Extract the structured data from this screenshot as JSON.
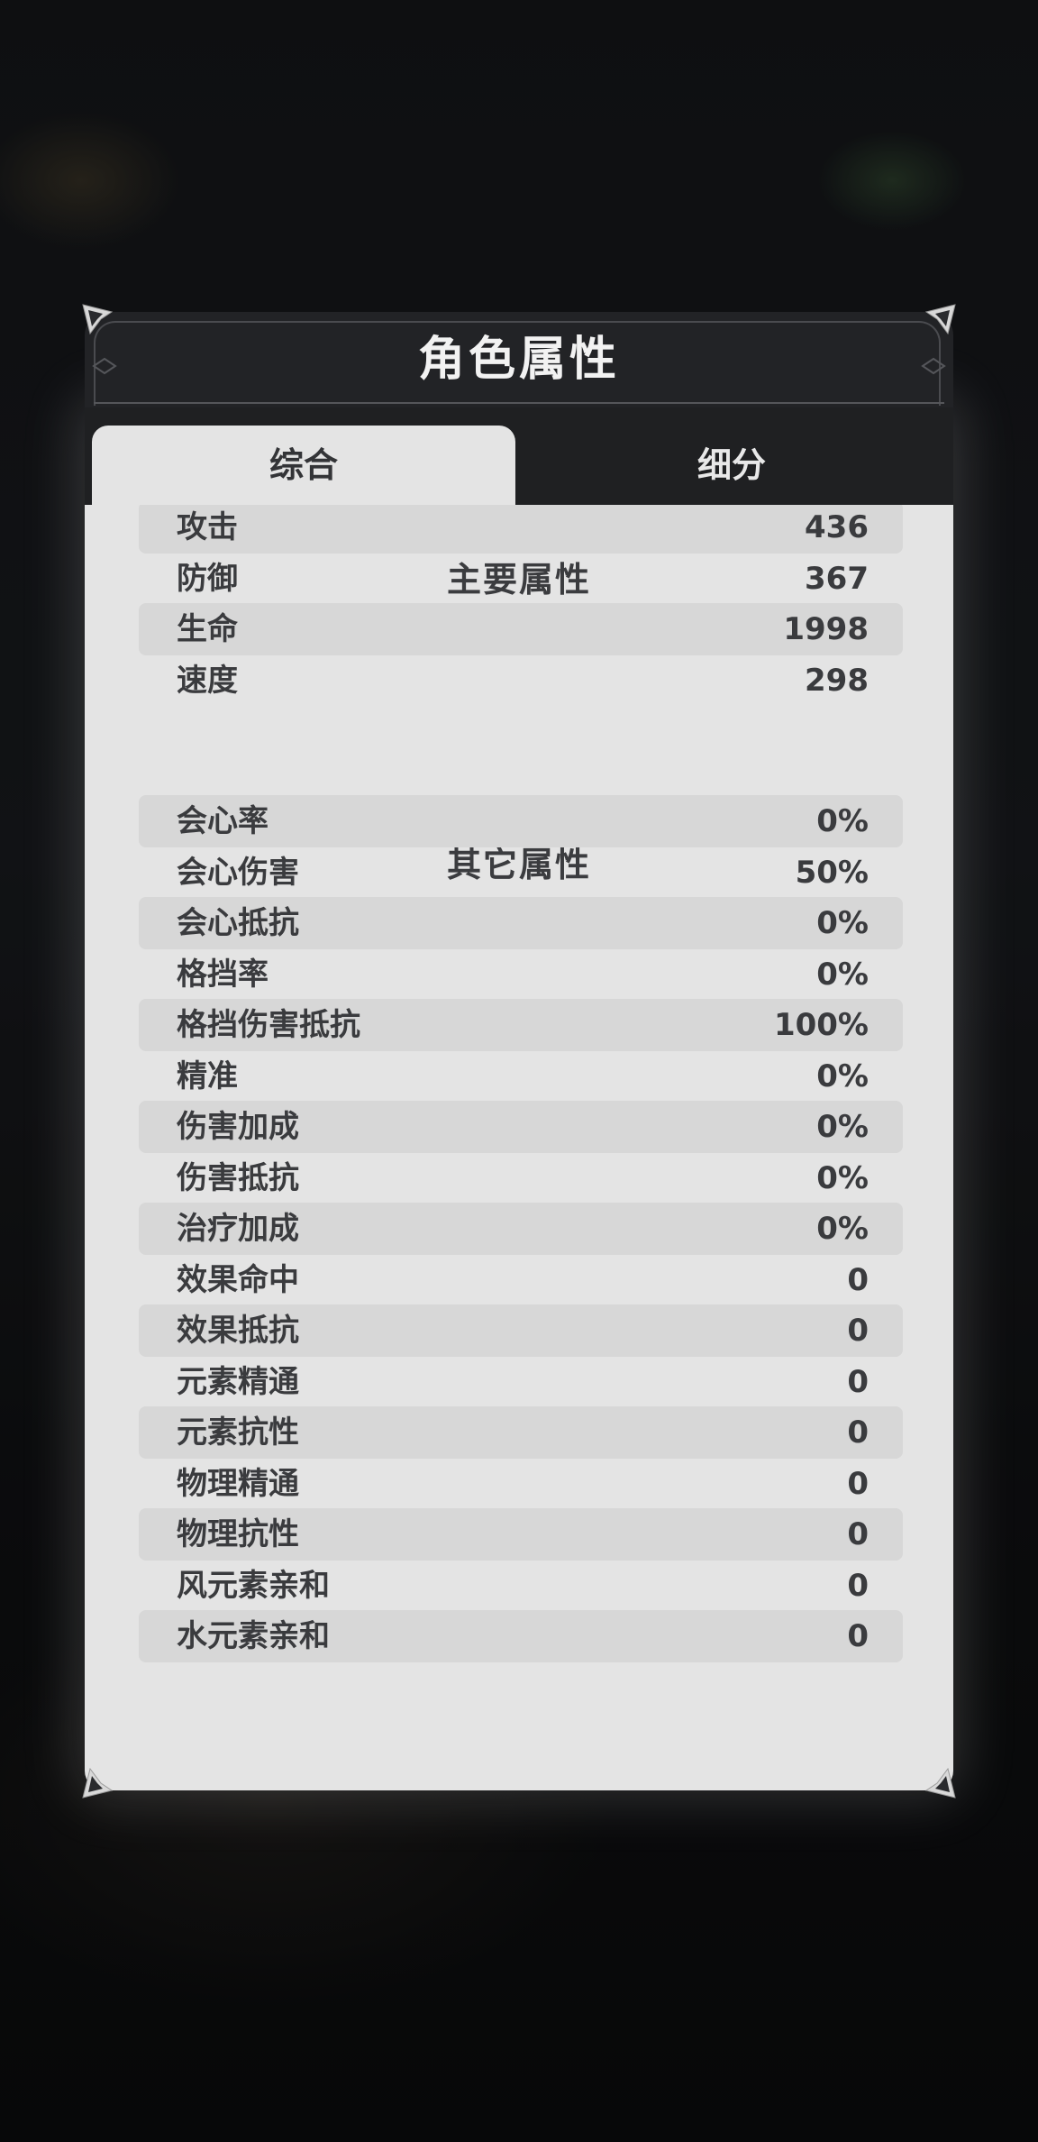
{
  "panel": {
    "title": "角色属性"
  },
  "tabs": [
    {
      "label": "综合",
      "active": true
    },
    {
      "label": "细分",
      "active": false
    }
  ],
  "sections": {
    "primary_title": "主要属性",
    "other_title": "其它属性"
  },
  "primary_stats": [
    {
      "label": "攻击",
      "value": "436"
    },
    {
      "label": "防御",
      "value": "367"
    },
    {
      "label": "生命",
      "value": "1998"
    },
    {
      "label": "速度",
      "value": "298"
    }
  ],
  "other_stats": [
    {
      "label": "会心率",
      "value": "0%"
    },
    {
      "label": "会心伤害",
      "value": "50%"
    },
    {
      "label": "会心抵抗",
      "value": "0%"
    },
    {
      "label": "格挡率",
      "value": "0%"
    },
    {
      "label": "格挡伤害抵抗",
      "value": "100%"
    },
    {
      "label": "精准",
      "value": "0%"
    },
    {
      "label": "伤害加成",
      "value": "0%"
    },
    {
      "label": "伤害抵抗",
      "value": "0%"
    },
    {
      "label": "治疗加成",
      "value": "0%"
    },
    {
      "label": "效果命中",
      "value": "0"
    },
    {
      "label": "效果抵抗",
      "value": "0"
    },
    {
      "label": "元素精通",
      "value": "0"
    },
    {
      "label": "元素抗性",
      "value": "0"
    },
    {
      "label": "物理精通",
      "value": "0"
    },
    {
      "label": "物理抗性",
      "value": "0"
    },
    {
      "label": "风元素亲和",
      "value": "0"
    },
    {
      "label": "水元素亲和",
      "value": "0"
    }
  ],
  "colors": {
    "header_bg": "#222326",
    "content_bg": "#e4e4e4",
    "row_shade": "#d7d7d7",
    "text_dark": "#3a3b3e",
    "text_light": "#f2f2f2"
  }
}
